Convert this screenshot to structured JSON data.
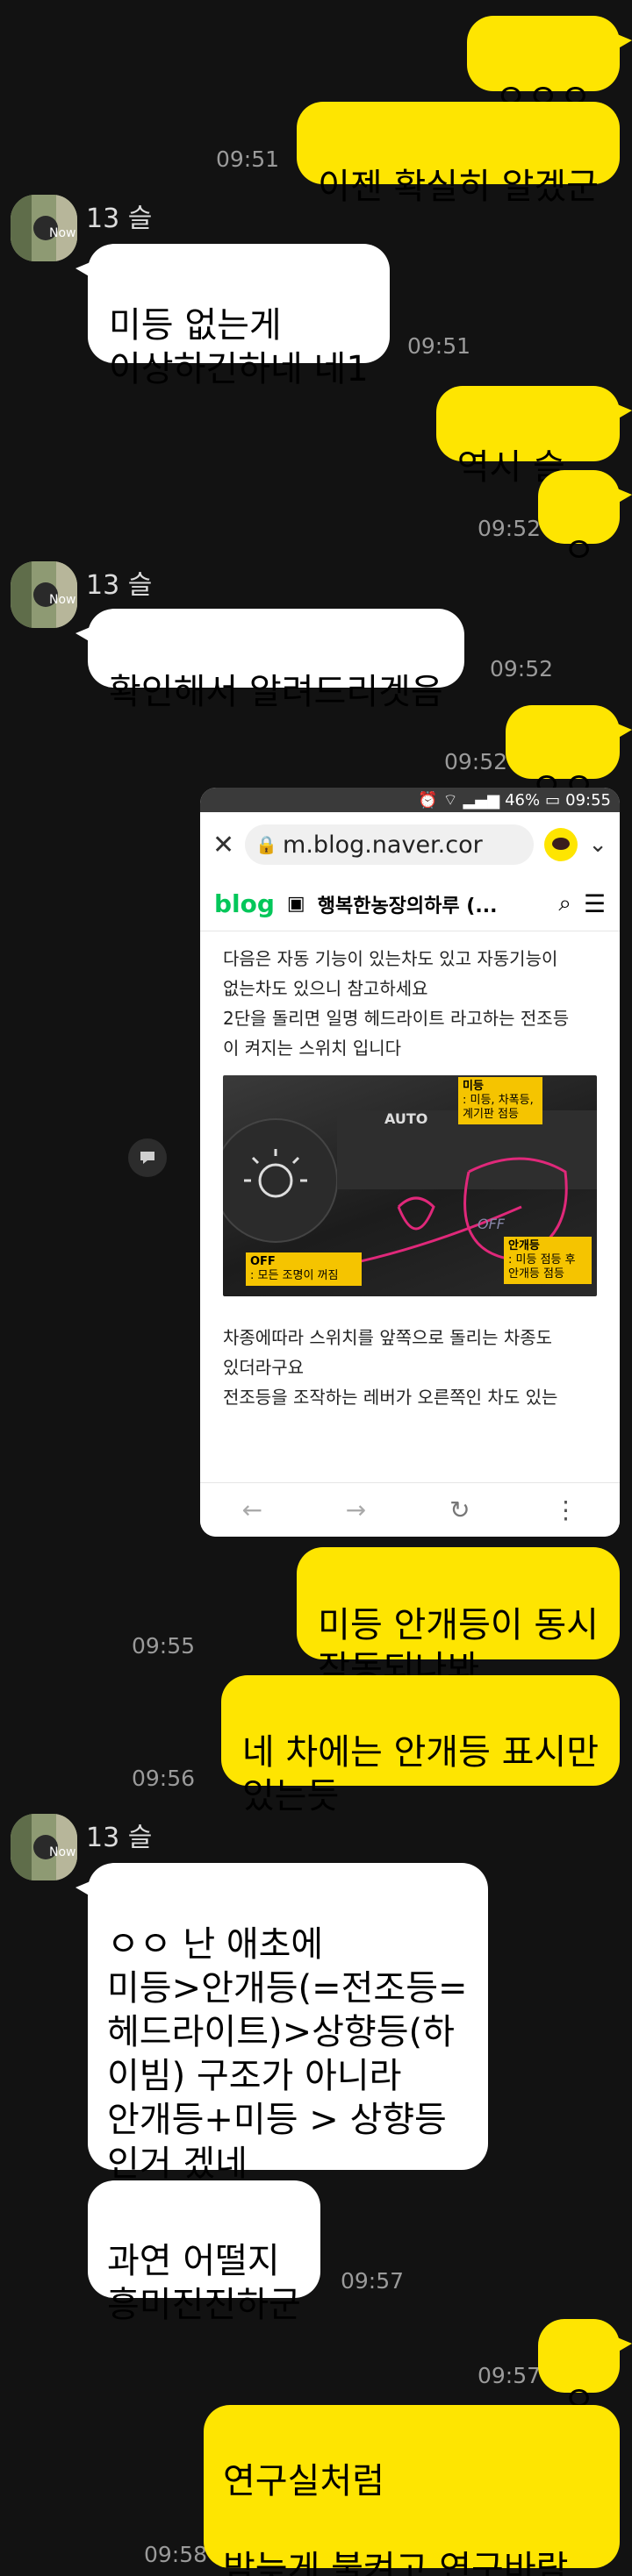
{
  "messages": [
    {
      "text": "ㅇㅇㅇ"
    },
    {
      "text": "이젠 확실히 알겠군",
      "time": "09:51"
    },
    {
      "sender": "13 슬",
      "text": "미등 없는게\n이상하긴하네 네1",
      "time": "09:51"
    },
    {
      "text": "역시 슬...",
      "time": ""
    },
    {
      "text": "ㅇ",
      "time": "09:52"
    },
    {
      "sender": "13 슬",
      "text": "확인해서 알려드리겟음",
      "time": "09:52"
    },
    {
      "text": "ㅇㅇ",
      "time": "09:52"
    },
    {
      "text": "미등 안개등이 동시\n작동되나봐",
      "time": "09:55"
    },
    {
      "text": "네 차에는 안개등 표시만\n있는듯",
      "time": "09:56"
    },
    {
      "sender": "13 슬",
      "text": "ㅇㅇ 난 애초에\n미등>안개등(=전조등=\n헤드라이트)>상향등(하\n이빔) 구조가 아니라\n안개등+미등 > 상향등\n인거 겠네"
    },
    {
      "text": "과연 어떨지\n흥미진진하군",
      "time": "09:57"
    },
    {
      "text": "ㅇ",
      "time": "09:57"
    },
    {
      "text": "연구실처럼\n\n밤늦게 불켜고 연구바람",
      "time": "09:58"
    }
  ],
  "shot": {
    "status": {
      "battery": "46%",
      "time": "09:55"
    },
    "url": "m.blog.naver.cor",
    "blog_brand": "blog",
    "blog_title": "행복한농장의하루 (...",
    "para1": "다음은 자동 기능이 있는차도 있고 자동기능이\n없는차도 있으니 참고하세요\n2단을 돌리면 일명 헤드라이트 라고하는 전조등\n이 켜지는 스위치 입니다",
    "photo": {
      "auto": "AUTO",
      "off_top": "OFF",
      "label_midung_title": "미등",
      "label_midung_body": ": 미등, 차폭등,\n계기판 점등",
      "label_off_title": "OFF",
      "label_off_body": ": 모든 조명이 꺼짐",
      "label_fog_title": "안개등",
      "label_fog_body": ": 미등 점등 후\n안개등 점등"
    },
    "para2": "차종에따라 스위치를 앞쪽으로 돌리는 차종도\n있더라구요\n전조등을 조작하는 레버가 오른쪽인 차도 있는"
  },
  "colors": {
    "bg": "#121212",
    "outgoing": "#fee501",
    "incoming": "#ffffff",
    "naver_green": "#03c75a"
  }
}
